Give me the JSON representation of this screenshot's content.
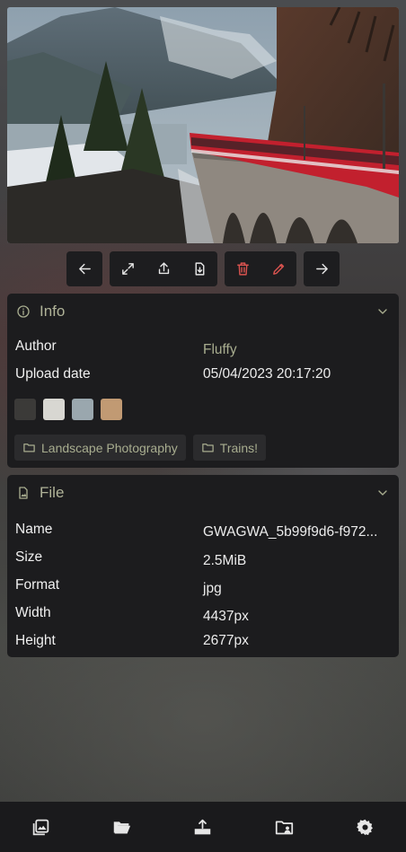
{
  "photo": {
    "alt_subject": "red train on stone viaduct"
  },
  "toolbar": {
    "icons": [
      "arrow-left-icon",
      "expand-icon",
      "share-icon",
      "download-icon",
      "trash-icon",
      "pencil-icon",
      "arrow-right-icon"
    ]
  },
  "info": {
    "title": "Info",
    "author_label": "Author",
    "author_value": "Fluffy",
    "upload_label": "Upload date",
    "upload_value": "05/04/2023 20:17:20",
    "colors": [
      "#3b3a38",
      "#d8d7d2",
      "#9aa7ae",
      "#c19a73"
    ],
    "tags": [
      "Landscape Photography",
      "Trains!"
    ]
  },
  "file": {
    "title": "File",
    "name_label": "Name",
    "name_value": "GWAGWA_5b99f9d6-f972...",
    "size_label": "Size",
    "size_value": "2.5MiB",
    "format_label": "Format",
    "format_value": "jpg",
    "width_label": "Width",
    "width_value": "4437px",
    "height_label": "Height",
    "height_value": "2677px"
  },
  "bottom_nav": {
    "icons": [
      "gallery-icon",
      "folder-open-icon",
      "upload-icon",
      "shared-folder-icon",
      "settings-icon"
    ]
  },
  "colors": {
    "accent_text": "#a8ad8f",
    "danger": "#d9534f",
    "card_bg": "#1c1c1e"
  }
}
